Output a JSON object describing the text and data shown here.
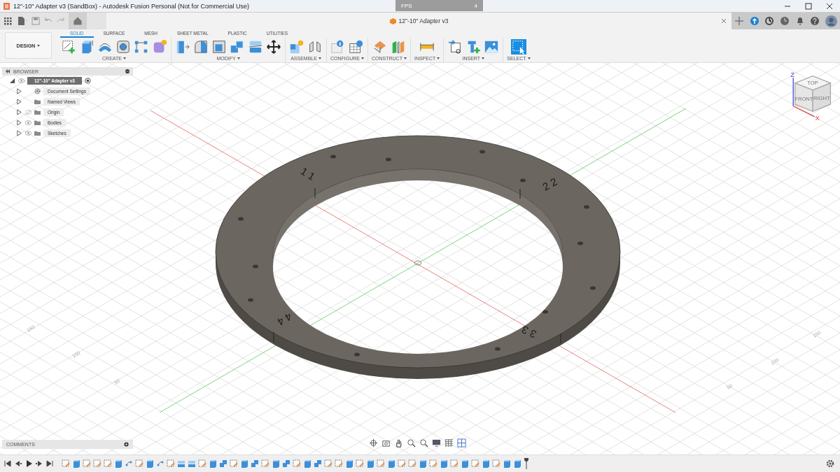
{
  "window": {
    "title": "12\"-10\" Adapter v3 (SandBox) - Autodesk Fusion Personal (Not for Commercial Use)"
  },
  "fps": {
    "label": "FPS",
    "value": "4"
  },
  "document_tab": {
    "title": "12\"-10\" Adapter v3"
  },
  "workspace": {
    "label": "DESIGN"
  },
  "ribbon_tabs": [
    {
      "label": "SOLID",
      "selected": true
    },
    {
      "label": "SURFACE",
      "selected": false
    },
    {
      "label": "MESH",
      "selected": false
    },
    {
      "label": "SHEET METAL",
      "selected": false
    },
    {
      "label": "PLASTIC",
      "selected": false
    },
    {
      "label": "UTILITIES",
      "selected": false
    }
  ],
  "ribbon_groups": [
    {
      "label": "CREATE",
      "tools": [
        {
          "kind": "sketch"
        },
        {
          "kind": "extrude"
        },
        {
          "kind": "revolve"
        },
        {
          "kind": "hole"
        },
        {
          "kind": "pattern"
        },
        {
          "kind": "form"
        }
      ]
    },
    {
      "label": "MODIFY",
      "tools": [
        {
          "kind": "presspull"
        },
        {
          "kind": "fillet"
        },
        {
          "kind": "shell"
        },
        {
          "kind": "combine"
        },
        {
          "kind": "split"
        },
        {
          "kind": "move"
        }
      ]
    },
    {
      "label": "ASSEMBLE",
      "tools": [
        {
          "kind": "component"
        },
        {
          "kind": "joint"
        }
      ]
    },
    {
      "label": "CONFIGURE",
      "tools": [
        {
          "kind": "configure"
        },
        {
          "kind": "table"
        }
      ]
    },
    {
      "label": "CONSTRUCT",
      "tools": [
        {
          "kind": "plane"
        },
        {
          "kind": "midplane"
        }
      ]
    },
    {
      "label": "INSPECT",
      "tools": [
        {
          "kind": "measure"
        }
      ]
    },
    {
      "label": "INSERT",
      "tools": [
        {
          "kind": "link"
        },
        {
          "kind": "decal"
        },
        {
          "kind": "canvas"
        }
      ]
    },
    {
      "label": "SELECT",
      "tools": [
        {
          "kind": "select"
        }
      ]
    }
  ],
  "browser": {
    "title": "BROWSER",
    "root": {
      "label": "12\"-10\" Adapter v3",
      "selected": true,
      "expanded": true,
      "visible": true,
      "children": [
        {
          "label": "Document Settings",
          "kind": "gear",
          "expanded": false,
          "selected": false
        },
        {
          "label": "Named Views",
          "kind": "folder",
          "expanded": false,
          "selected": false
        },
        {
          "label": "Origin",
          "kind": "folder",
          "visible": false,
          "expanded": false,
          "selected": false
        },
        {
          "label": "Bodies",
          "kind": "folder",
          "visible": true,
          "expanded": false,
          "selected": false
        },
        {
          "label": "Sketches",
          "kind": "folder",
          "visible": true,
          "expanded": false,
          "selected": false
        }
      ]
    }
  },
  "comments": {
    "title": "COMMENTS"
  },
  "viewcube": {
    "faces": [
      "TOP",
      "FRONT",
      "RIGHT"
    ],
    "axes": [
      "Z",
      "X"
    ]
  },
  "part_labels": [
    "1 1",
    "2 2",
    "3 3",
    "4 4"
  ],
  "grid_labels": [
    "150",
    "100",
    "50",
    "150",
    "100",
    "50"
  ],
  "timeline": {
    "features": [
      {
        "kind": "sketch"
      },
      {
        "kind": "body"
      },
      {
        "kind": "sketch"
      },
      {
        "kind": "sketch"
      },
      {
        "kind": "sketch"
      },
      {
        "kind": "body"
      },
      {
        "kind": "constraint"
      },
      {
        "kind": "sketch"
      },
      {
        "kind": "body"
      },
      {
        "kind": "constraint"
      },
      {
        "kind": "sketch"
      },
      {
        "kind": "stack"
      },
      {
        "kind": "stack"
      },
      {
        "kind": "sketch"
      },
      {
        "kind": "body"
      },
      {
        "kind": "combine"
      },
      {
        "kind": "sketch"
      },
      {
        "kind": "body"
      },
      {
        "kind": "combine"
      },
      {
        "kind": "sketch"
      },
      {
        "kind": "body"
      },
      {
        "kind": "combine"
      },
      {
        "kind": "sketch"
      },
      {
        "kind": "body"
      },
      {
        "kind": "combine"
      },
      {
        "kind": "sketch"
      },
      {
        "kind": "sketch"
      },
      {
        "kind": "body"
      },
      {
        "kind": "sketch"
      },
      {
        "kind": "body"
      },
      {
        "kind": "sketch"
      },
      {
        "kind": "body"
      },
      {
        "kind": "sketch"
      },
      {
        "kind": "sketch"
      },
      {
        "kind": "body"
      },
      {
        "kind": "sketch"
      },
      {
        "kind": "body"
      },
      {
        "kind": "sketch"
      },
      {
        "kind": "body"
      },
      {
        "kind": "sketch"
      },
      {
        "kind": "body"
      },
      {
        "kind": "sketch"
      },
      {
        "kind": "body"
      },
      {
        "kind": "body"
      }
    ]
  }
}
